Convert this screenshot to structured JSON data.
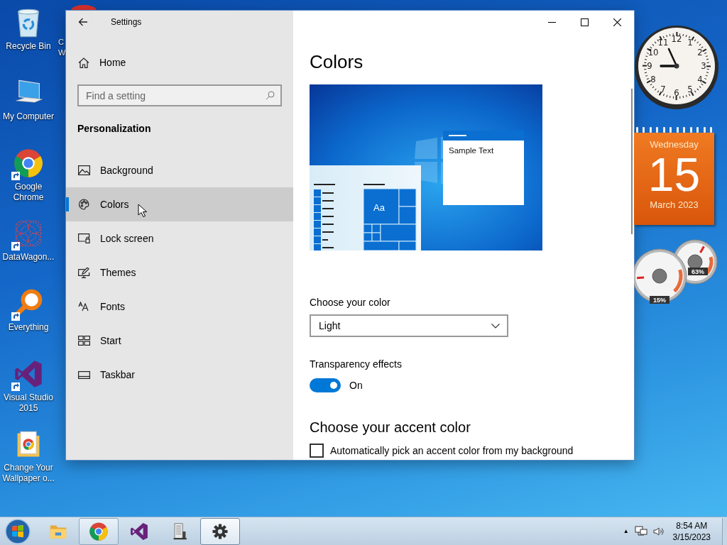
{
  "desktop_icons": [
    {
      "kind": "recycle-bin",
      "label": "Recycle Bin",
      "shortcut": false
    },
    {
      "kind": "computer",
      "label": "My Computer",
      "shortcut": false
    },
    {
      "kind": "chrome",
      "label": "Google\nChrome",
      "shortcut": true
    },
    {
      "kind": "network-graph",
      "label": "DataWagon...",
      "shortcut": true
    },
    {
      "kind": "magnifier",
      "label": "Everything",
      "shortcut": true
    },
    {
      "kind": "visual-studio",
      "label": "Visual Studio\n2015",
      "shortcut": true
    },
    {
      "kind": "folder-chrome",
      "label": "Change Your\nWallpaper o...",
      "shortcut": false
    }
  ],
  "hidden_icon": {
    "label": "C\nW"
  },
  "settings_window": {
    "title": "Settings",
    "home": "Home",
    "search": {
      "placeholder": "Find a setting"
    },
    "section": "Personalization",
    "nav_items": [
      {
        "kind": "picture",
        "label": "Background",
        "selected": false
      },
      {
        "kind": "palette",
        "label": "Colors",
        "selected": true
      },
      {
        "kind": "lock-screen",
        "label": "Lock screen",
        "selected": false
      },
      {
        "kind": "themes",
        "label": "Themes",
        "selected": false
      },
      {
        "kind": "fonts",
        "label": "Fonts",
        "selected": false
      },
      {
        "kind": "start",
        "label": "Start",
        "selected": false
      },
      {
        "kind": "taskbar",
        "label": "Taskbar",
        "selected": false
      }
    ],
    "heading": "Colors",
    "preview": {
      "sample_text": "Sample Text",
      "tile_label": "Aa"
    },
    "color_mode": {
      "label": "Choose your color",
      "value": "Light"
    },
    "transparency": {
      "label": "Transparency effects",
      "on": true,
      "state_text": "On"
    },
    "accent_heading": "Choose your accent color",
    "auto_accent": {
      "label": "Automatically pick an accent color from my background",
      "checked": false
    }
  },
  "gadgets": {
    "clock": {
      "numerals": [
        "12",
        "11",
        "1",
        "10",
        "2",
        "9",
        "3",
        "8",
        "4",
        "7",
        "5",
        "6"
      ]
    },
    "calendar": {
      "weekday": "Wednesday",
      "day": "15",
      "month": "March 2023"
    },
    "meters": [
      {
        "reading": "15%"
      },
      {
        "reading": "63%"
      }
    ]
  },
  "taskbar": {
    "apps": [
      {
        "kind": "folder",
        "open": false,
        "selected": false
      },
      {
        "kind": "chrome",
        "open": true,
        "selected": false
      },
      {
        "kind": "visual-studio",
        "open": false,
        "selected": false
      },
      {
        "kind": "document",
        "open": false,
        "selected": false
      },
      {
        "kind": "settings",
        "open": true,
        "selected": true
      }
    ],
    "tray_arrow": "▲",
    "time": "8:54 AM",
    "date": "3/15/2023"
  }
}
